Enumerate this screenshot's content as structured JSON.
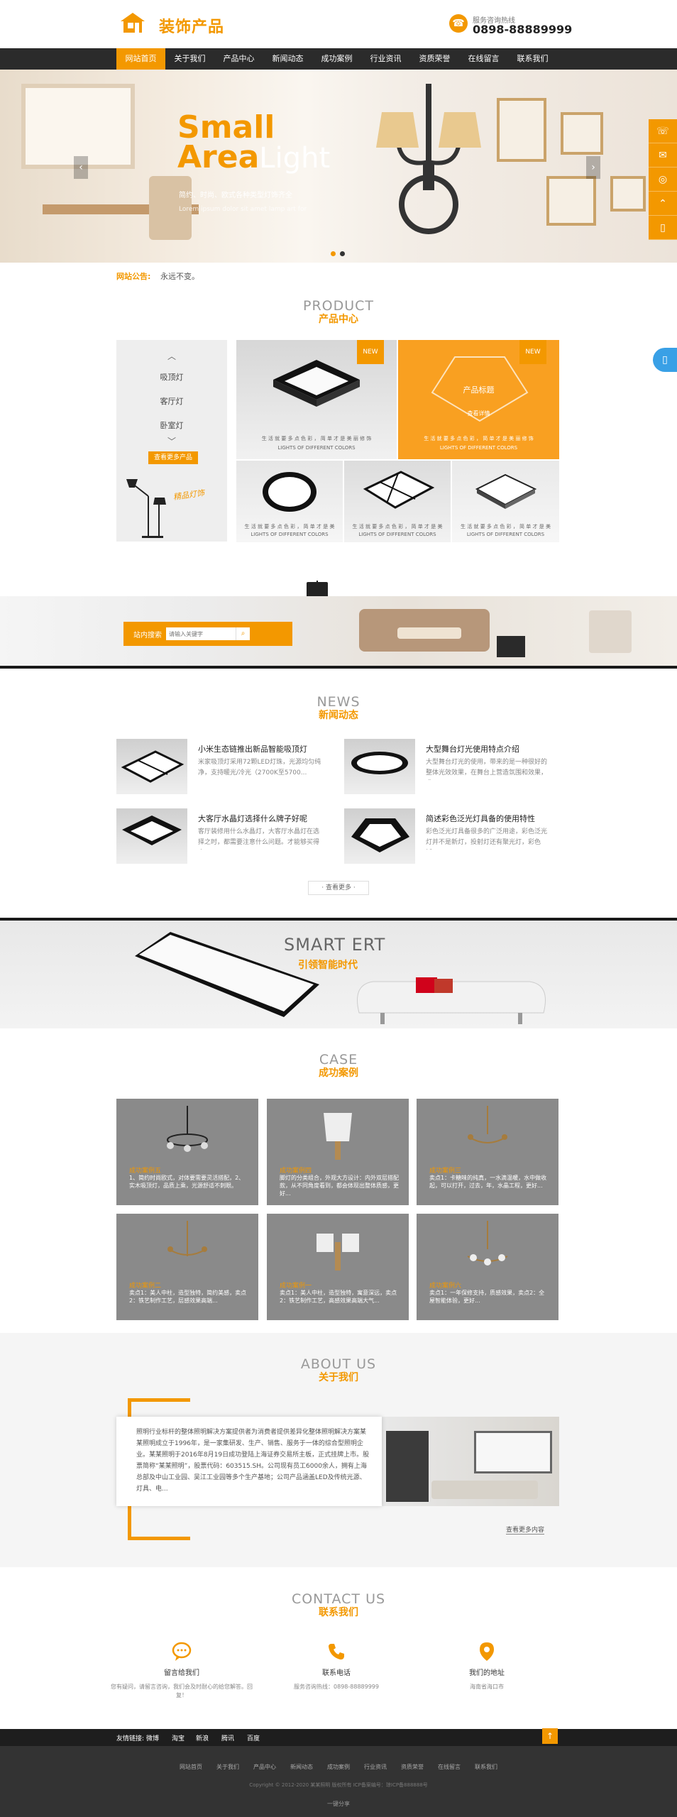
{
  "header": {
    "logo_text": "装饰产品",
    "phone_label": "服务咨询热线",
    "phone_number": "0898-88889999"
  },
  "nav": {
    "items": [
      "网站首页",
      "关于我们",
      "产品中心",
      "新闻动态",
      "成功案例",
      "行业资讯",
      "资质荣誉",
      "在线留言",
      "联系我们"
    ],
    "active_index": 0
  },
  "banner": {
    "title_line1": "Small",
    "title_line2_bold": "Area",
    "title_line2_light": "Light",
    "subtitle": "简约、时尚、欧式各种类型灯饰齐全",
    "subtitle_en": "Lorem ipsum dolor sit amet lamp art for",
    "prev_icon": "chevron-left-icon",
    "next_icon": "chevron-right-icon",
    "slides": 2,
    "current_slide": 1
  },
  "side_float": {
    "icons": [
      "phone-icon",
      "qq-icon",
      "wechat-icon",
      "top-icon",
      "mobile-icon"
    ]
  },
  "notice": {
    "label": "网站公告:",
    "text": "永远不变。"
  },
  "product": {
    "title_en": "PRODUCT",
    "title_cn": "产品中心",
    "categories": [
      "吸顶灯",
      "客厅灯",
      "卧室灯"
    ],
    "more_label": "查看更多产品",
    "lamp_slogan": "精品灯饰",
    "tile_a_badge": "NEW",
    "tile_a_caption": "生 活 就 要 多 点 色 彩 ， 简 单 才 是 美 丽 修 饰",
    "tile_a_caption_en": "LIGHTS OF DIFFERENT COLORS",
    "tile_b_badge": "NEW",
    "tile_b_name": "产品标题",
    "tile_b_more": "查看详情",
    "small_caption": "生 活 就 要 多 点 色 彩 ， 简 单 才 是 美",
    "small_caption_en": "LIGHTS OF DIFFERENT COLORS"
  },
  "search": {
    "label": "站内搜索",
    "placeholder": "请输入关键字",
    "button_icon": "search-icon"
  },
  "news": {
    "title_en": "NEWS",
    "title_cn": "新闻动态",
    "items": [
      {
        "title": "小米生态链推出新品智能吸顶灯",
        "desc": "米家吸顶灯采用72颗LED灯珠，光源均匀纯净，支持暖光/冷光（2700K至5700..."
      },
      {
        "title": "大型舞台灯光使用特点介绍",
        "desc": "大型舞台灯光的使用，带来的是一种很好的整体光效效果，在舞台上营造氛围和效果，尤..."
      },
      {
        "title": "大客厅水晶灯选择什么牌子好呢",
        "desc": "客厅装修用什么水晶灯，大客厅水晶灯在选择之时，都需要注意什么问题。才能够买得出..."
      },
      {
        "title": "简述彩色泛光灯具备的使用特性",
        "desc": "彩色泛光灯具备很多的广泛用途，彩色泛光灯并不是新灯，投射灯还有聚光灯，彩色泛..."
      }
    ],
    "more_label": "· 查看更多 ·"
  },
  "smart": {
    "title_en": "SMART ERT",
    "title_cn": "引领智能时代"
  },
  "cases": {
    "title_en": "CASE",
    "title_cn": "成功案例",
    "items": [
      {
        "title": "成功案例五",
        "desc": "1、简约时尚欧式，对体要需要灵活搭配，2、实木吸顶灯，品质上乘，光源舒适不刺眼。"
      },
      {
        "title": "成功案例四",
        "desc": "脚灯的分类组合，外观大方设计：内外双层搭配款，从不同角度看到，都会体现出整体质感，更好..."
      },
      {
        "title": "成功案例三",
        "desc": "卖点1：卡糖味的纯真，一水滴温暖，水中做收起，可以打开，过去，年，水晶工程，更好..."
      },
      {
        "title": "成功案例二",
        "desc": "卖点1：美人中柱，造型独特，简约美感，卖点2：铁艺制作工艺，层感效果高端..."
      },
      {
        "title": "成功案例一",
        "desc": "卖点1：美人中柱，造型独特，寓意深远，卖点2：铁艺制作工艺，高感效果高端大气..."
      },
      {
        "title": "成功案例六",
        "desc": "卖点1：一年保修支持，质感效果，卖点2：全屋智能体验，更好..."
      }
    ]
  },
  "about": {
    "title_en": "ABOUT US",
    "title_cn": "关于我们",
    "text": "照明行业标杆的整体照明解决方案提供者为消费者提供差异化整体照明解决方案某某照明成立于1996年，是一家集研发、生产、销售、服务于一体的综合型照明企业。某某照明于2016年8月19日成功登陆上海证券交易所主板，正式挂牌上市。股票简称“某某照明”，股票代码：603515.SH。公司现有员工6000余人，拥有上海总部及中山工业园、吴江工业园等多个生产基地；公司产品涵盖LED及传统光源、灯具、电...",
    "more_label": "查看更多内容"
  },
  "contact": {
    "title_en": "CONTACT US",
    "title_cn": "联系我们",
    "items": [
      {
        "icon": "chat-icon",
        "name": "留言给我们",
        "desc": "您有疑问，请留言咨询，我们会及时耐心的给您解答。回复！"
      },
      {
        "icon": "phone-icon",
        "name": "联系电话",
        "desc": "服务咨询热线：0898-88889999"
      },
      {
        "icon": "location-icon",
        "name": "我们的地址",
        "desc": "海南省海口市"
      }
    ]
  },
  "footer": {
    "friend_label": "友情链接:",
    "friend_links": [
      "微博",
      "淘宝",
      "新浪",
      "腾讯",
      "百度"
    ],
    "nav": [
      "网站首页",
      "关于我们",
      "产品中心",
      "新闻动态",
      "成功案例",
      "行业资讯",
      "资质荣誉",
      "在线留言",
      "联系我们"
    ],
    "copyright": "Copyright © 2012-2020 某某照明 版权所有   ICP备案编号：琼ICP备888888号",
    "share": "一键分享"
  },
  "colors": {
    "accent": "#f39800",
    "nav_bg": "#2b2b2b",
    "footer_bg": "#333333"
  }
}
